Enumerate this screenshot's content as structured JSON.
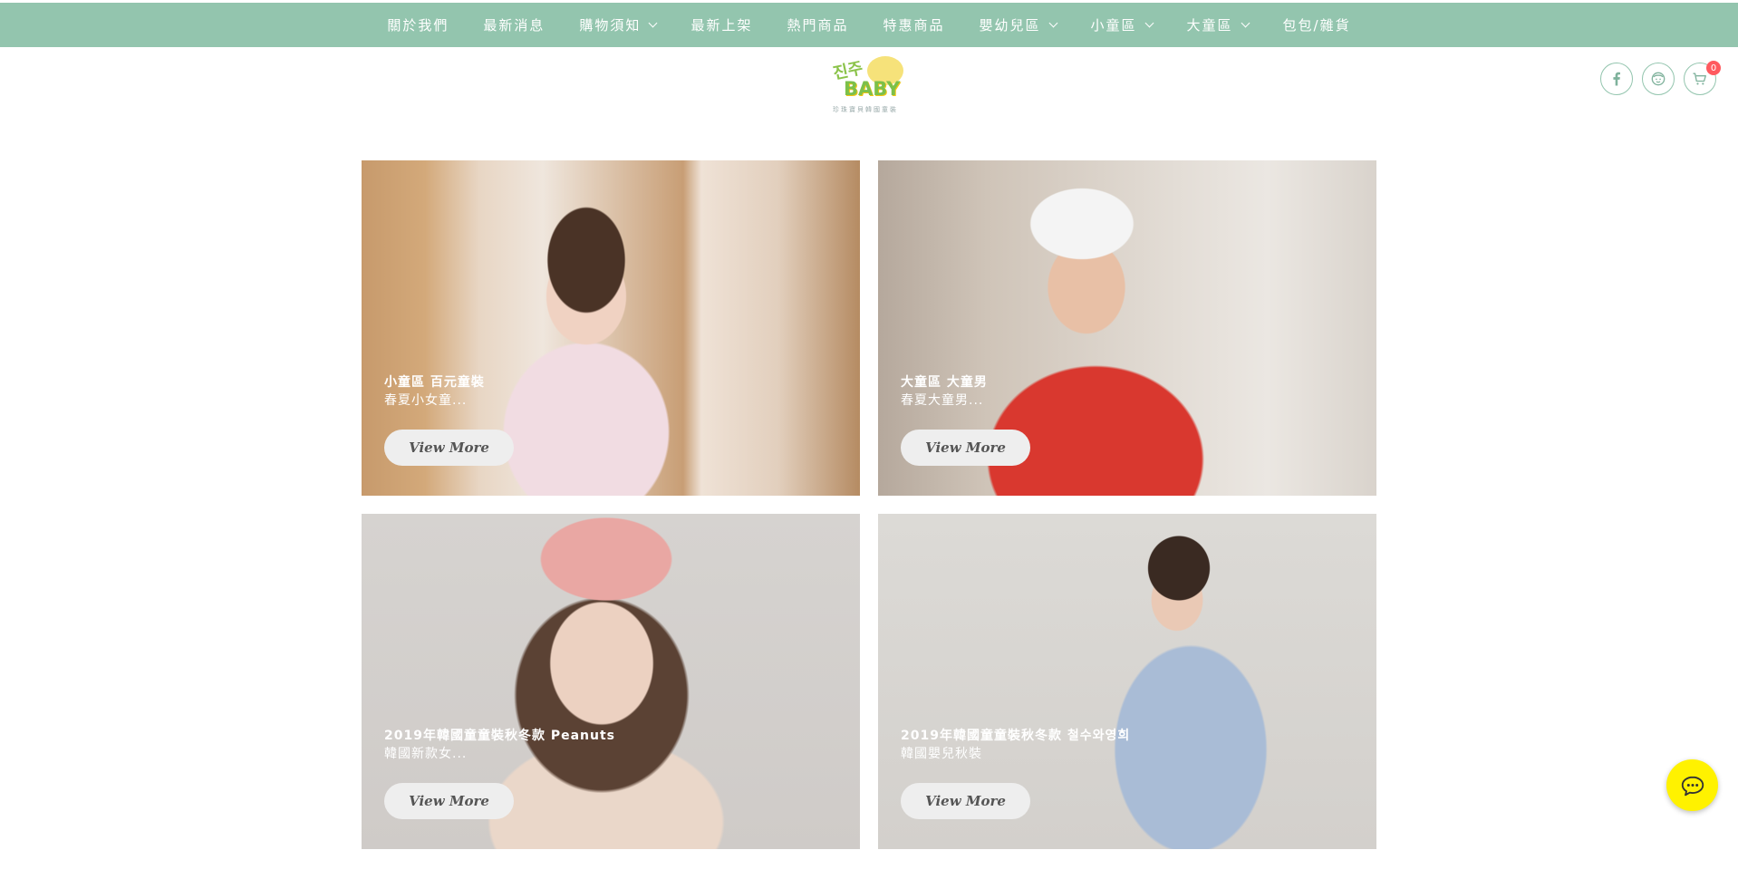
{
  "nav": {
    "items": [
      {
        "label": "關於我們",
        "dropdown": false
      },
      {
        "label": "最新消息",
        "dropdown": false
      },
      {
        "label": "購物須知",
        "dropdown": true
      },
      {
        "label": "最新上架",
        "dropdown": false
      },
      {
        "label": "熱門商品",
        "dropdown": false
      },
      {
        "label": "特惠商品",
        "dropdown": false
      },
      {
        "label": "嬰幼兒區",
        "dropdown": true
      },
      {
        "label": "小童區",
        "dropdown": true
      },
      {
        "label": "大童區",
        "dropdown": true
      },
      {
        "label": "包包/雜貨",
        "dropdown": false
      }
    ]
  },
  "logo": {
    "korean": "진주",
    "brand": "BABY",
    "tagline": "珍珠寶貝韓國童裝"
  },
  "header_icons": {
    "facebook": "facebook-icon",
    "member": "member-icon",
    "cart": "cart-icon",
    "cart_count": "0"
  },
  "cards": [
    {
      "title": "小童區 百元童裝",
      "subtitle": "春夏小女童...",
      "button": "View More"
    },
    {
      "title": "大童區 大童男",
      "subtitle": "春夏大童男...",
      "button": "View More"
    },
    {
      "title": "2019年韓國童童裝秋冬款 Peanuts",
      "subtitle": "韓國新款女...",
      "button": "View More"
    },
    {
      "title": "2019年韓國童童裝秋冬款 철수와영희",
      "subtitle": "韓國嬰兒秋裝",
      "button": "View More"
    }
  ],
  "chat": {
    "icon": "chat-icon"
  },
  "colors": {
    "brand": "#93c5ae",
    "chat": "#fff200",
    "badge": "#ff5a5f"
  }
}
